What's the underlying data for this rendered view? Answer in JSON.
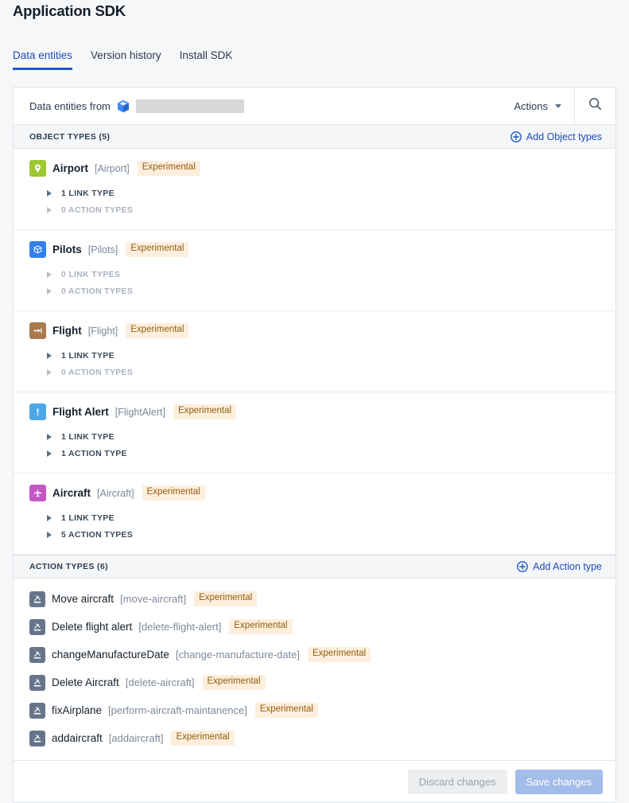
{
  "header": {
    "title": "Application SDK",
    "tabs": [
      {
        "label": "Data entities",
        "active": true
      },
      {
        "label": "Version history",
        "active": false
      },
      {
        "label": "Install SDK",
        "active": false
      }
    ]
  },
  "source_bar": {
    "label": "Data entities from",
    "source_icon": "ontology-cube-icon",
    "source_value": "",
    "redacted": true,
    "actions_label": "Actions",
    "search_icon": "search-icon"
  },
  "object_types_section": {
    "label": "OBJECT TYPES (5)",
    "add_label": "Add Object types",
    "items": [
      {
        "name": "Airport",
        "api_name": "[Airport]",
        "tag": "Experimental",
        "icon": "map-pin-icon",
        "icon_color": "#9ec831",
        "link_types": {
          "text": "1 LINK TYPE",
          "muted": false
        },
        "action_types": {
          "text": "0 ACTION TYPES",
          "muted": true
        }
      },
      {
        "name": "Pilots",
        "api_name": "[Pilots]",
        "tag": "Experimental",
        "icon": "cube-icon",
        "icon_color": "#337ff0",
        "link_types": {
          "text": "0 LINK TYPES",
          "muted": true
        },
        "action_types": {
          "text": "0 ACTION TYPES",
          "muted": true
        }
      },
      {
        "name": "Flight",
        "api_name": "[Flight]",
        "tag": "Experimental",
        "icon": "arrow-to-pin-icon",
        "icon_color": "#a87b4c",
        "link_types": {
          "text": "1 LINK TYPE",
          "muted": false
        },
        "action_types": {
          "text": "0 ACTION TYPES",
          "muted": true
        }
      },
      {
        "name": "Flight Alert",
        "api_name": "[FlightAlert]",
        "tag": "Experimental",
        "icon": "exclamation-icon",
        "icon_color": "#4da6e8",
        "link_types": {
          "text": "1 LINK TYPE",
          "muted": false
        },
        "action_types": {
          "text": "1 ACTION TYPE",
          "muted": false
        }
      },
      {
        "name": "Aircraft",
        "api_name": "[Aircraft]",
        "tag": "Experimental",
        "icon": "airplane-icon",
        "icon_color": "#c457c4",
        "link_types": {
          "text": "1 LINK TYPE",
          "muted": false
        },
        "action_types": {
          "text": "5 ACTION TYPES",
          "muted": false
        }
      }
    ]
  },
  "action_types_section": {
    "label": "ACTION TYPES (6)",
    "add_label": "Add Action type",
    "items": [
      {
        "name": "Move aircraft",
        "api_name": "[move-aircraft]",
        "tag": "Experimental",
        "icon": "gavel-icon"
      },
      {
        "name": "Delete flight alert",
        "api_name": "[delete-flight-alert]",
        "tag": "Experimental",
        "icon": "gavel-icon"
      },
      {
        "name": "changeManufactureDate",
        "api_name": "[change-manufacture-date]",
        "tag": "Experimental",
        "icon": "gavel-icon"
      },
      {
        "name": "Delete Aircraft",
        "api_name": "[delete-aircraft]",
        "tag": "Experimental",
        "icon": "gavel-icon"
      },
      {
        "name": "fixAirplane",
        "api_name": "[perform-aircraft-maintanence]",
        "tag": "Experimental",
        "icon": "gavel-icon"
      },
      {
        "name": "addaircraft",
        "api_name": "[addaircraft]",
        "tag": "Experimental",
        "icon": "gavel-icon"
      }
    ]
  },
  "footer": {
    "discard_label": "Discard changes",
    "save_label": "Save changes",
    "discard_disabled": true,
    "save_disabled": true
  },
  "colors": {
    "accent_link": "#1f4bb8",
    "tag_bg": "#fdeedd",
    "tag_text": "#93600f",
    "page_bg": "#f6f7f9",
    "save_button": "#a3bdea"
  }
}
